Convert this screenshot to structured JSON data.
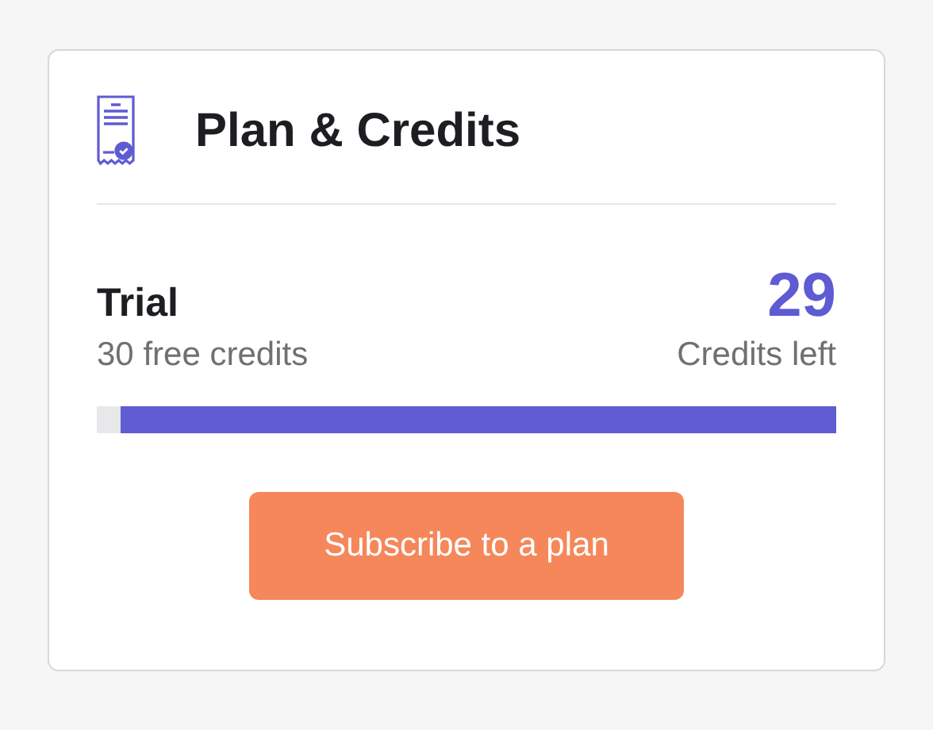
{
  "card": {
    "title": "Plan & Credits"
  },
  "plan": {
    "name": "Trial",
    "description": "30 free credits",
    "credits": "29",
    "credits_label": "Credits left",
    "level": 0.967
  },
  "button": {
    "label": "Subscribe to a plan"
  }
}
